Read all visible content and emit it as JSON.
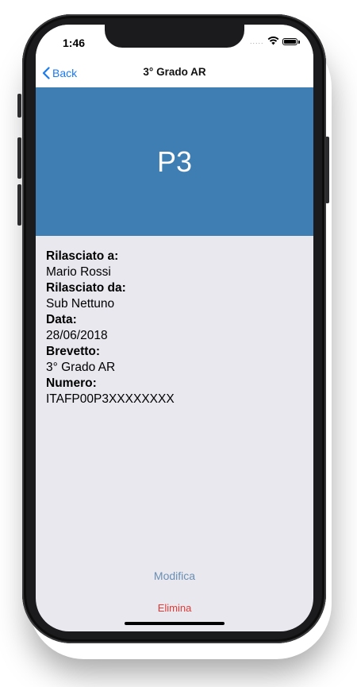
{
  "status_bar": {
    "time": "1:46",
    "signal": "....."
  },
  "nav": {
    "back_label": "Back",
    "title": "3° Grado AR"
  },
  "header": {
    "code": "P3",
    "background_color": "#3f7eb3"
  },
  "details": [
    {
      "label": "Rilasciato a:",
      "value": "Mario Rossi"
    },
    {
      "label": "Rilasciato da:",
      "value": "Sub Nettuno"
    },
    {
      "label": "Data:",
      "value": "28/06/2018"
    },
    {
      "label": "Brevetto:",
      "value": "3° Grado AR"
    },
    {
      "label": "Numero:",
      "value": "ITAFP00P3XXXXXXXX"
    }
  ],
  "actions": {
    "edit_label": "Modifica",
    "delete_label": "Elimina"
  },
  "colors": {
    "accent": "#1a7af2",
    "edit": "#6a8fb3",
    "delete": "#e13a36",
    "background": "#e9e8ee"
  },
  "icons": {
    "back": "chevron-left-icon",
    "wifi": "wifi-icon",
    "battery": "battery-icon"
  }
}
